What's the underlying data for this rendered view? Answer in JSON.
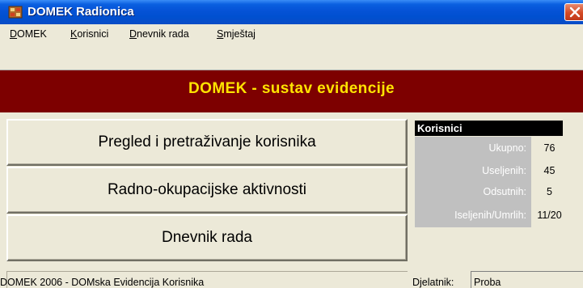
{
  "window": {
    "title": "DOMEK Radionica"
  },
  "menu": {
    "items": [
      {
        "label": "DOMEK"
      },
      {
        "label": "Korisnici"
      },
      {
        "label": "Dnevnik rada"
      },
      {
        "label": "Smještaj"
      }
    ]
  },
  "banner": {
    "title": "DOMEK - sustav evidencije"
  },
  "buttons": [
    {
      "label": "Pregled i pretraživanje korisnika"
    },
    {
      "label": "Radno-okupacijske aktivnosti"
    },
    {
      "label": "Dnevnik rada"
    }
  ],
  "stats": {
    "header": "Korisnici",
    "rows": [
      {
        "label": "Ukupno:",
        "value": "76"
      },
      {
        "label": "Useljenih:",
        "value": "45"
      },
      {
        "label": "Odsutnih:",
        "value": "5"
      },
      {
        "label": "Iseljenih/Umrlih:",
        "value": "11/20"
      }
    ]
  },
  "status": {
    "text": "DOMEK 2006 - DOMska Evidencija Korisnika",
    "worker_label": "Djelatnik:",
    "worker_value": "Proba"
  },
  "colors": {
    "titlebar": "#0552d6",
    "banner_bg": "#7d0000",
    "banner_text": "#ffe400",
    "window_bg": "#ece9d8",
    "stats_label_bg": "#c0c0c0"
  },
  "icons": {
    "app": "app-icon",
    "close": "close-icon"
  }
}
